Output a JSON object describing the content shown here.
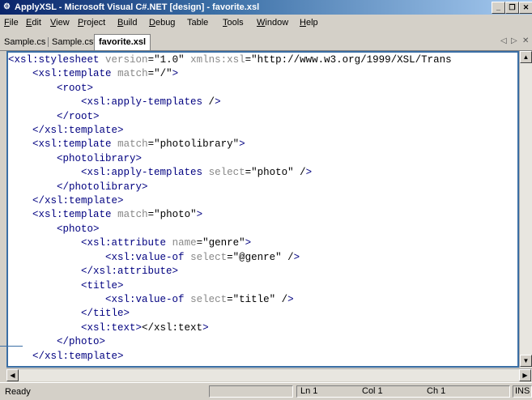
{
  "window": {
    "title": "ApplyXSL - Microsoft Visual C#.NET [design] - favorite.xsl",
    "minimize": "_",
    "restore": "❐",
    "close": "✕",
    "app_icon": "vs-app-icon"
  },
  "menu": [
    {
      "label": "File",
      "u": "F",
      "rest": "ile"
    },
    {
      "label": "Edit",
      "u": "E",
      "rest": "dit"
    },
    {
      "label": "View",
      "u": "V",
      "rest": "iew"
    },
    {
      "label": "Project",
      "u": "P",
      "rest": "roject"
    },
    {
      "label": "Build",
      "u": "B",
      "rest": "uild"
    },
    {
      "label": "Debug",
      "u": "D",
      "rest": "ebug"
    },
    {
      "label": "Table",
      "u": "",
      "rest": "Table"
    },
    {
      "label": "Tools",
      "u": "T",
      "rest": "ools"
    },
    {
      "label": "Window",
      "u": "W",
      "rest": "indow"
    },
    {
      "label": "Help",
      "u": "H",
      "rest": "elp"
    }
  ],
  "tabs": [
    {
      "label": "Sample.cs"
    },
    {
      "label": "Sample.cs*"
    },
    {
      "label": "favorite.xsl",
      "active": true
    }
  ],
  "tab_nav": {
    "prev": "◁",
    "next": "▷",
    "close": "✕"
  },
  "code_lines": [
    "<xsl:stylesheet version=\"1.0\" xmlns:xsl=\"http://www.w3.org/1999/XSL/Trans",
    "    <xsl:template match=\"/\">",
    "        <root>",
    "            <xsl:apply-templates />",
    "        </root>",
    "    </xsl:template>",
    "    <xsl:template match=\"photolibrary\">",
    "        <photolibrary>",
    "            <xsl:apply-templates select=\"photo\" />",
    "        </photolibrary>",
    "    </xsl:template>",
    "    <xsl:template match=\"photo\">",
    "        <photo>",
    "            <xsl:attribute name=\"genre\">",
    "                <xsl:value-of select=\"@genre\" />",
    "            </xsl:attribute>",
    "            <title>",
    "                <xsl:value-of select=\"title\" />",
    "            </title>",
    "            <xsl:text></xsl:text>",
    "        </photo>",
    "    </xsl:template>"
  ],
  "status": {
    "ready": "Ready",
    "ln": "Ln 1",
    "col": "Col 1",
    "ch": "Ch 1",
    "ins": "INS"
  },
  "colors": {
    "tag": "#000080",
    "attr": "#888888",
    "editor_border": "#3a6ea5"
  }
}
